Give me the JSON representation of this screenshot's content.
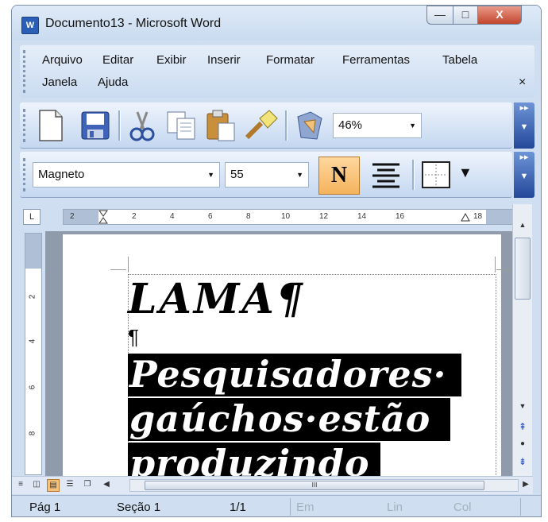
{
  "window": {
    "app_icon_glyph": "W",
    "title": "Documento13 - Microsoft Word",
    "minimize_glyph": "—",
    "maximize_glyph": "□",
    "close_glyph": "X"
  },
  "menu": {
    "items": [
      "Arquivo",
      "Editar",
      "Exibir",
      "Inserir",
      "Formatar",
      "Ferramentas",
      "Tabela",
      "Janela",
      "Ajuda"
    ],
    "close_glyph": "×"
  },
  "toolbar_standard": {
    "zoom": "46%",
    "icons": [
      "new-document-icon",
      "save-icon",
      "cut-icon",
      "copy-icon",
      "paste-icon",
      "format-painter-icon",
      "drawing-icon"
    ]
  },
  "toolbar_formatting": {
    "font": "Magneto",
    "size": "55",
    "bold_label": "N",
    "borders_arrow": "▼"
  },
  "ruler": {
    "corner": "L",
    "labels": [
      "2",
      "2",
      "4",
      "6",
      "8",
      "10",
      "12",
      "14",
      "16",
      "18"
    ],
    "vertical_labels": [
      "2",
      "4",
      "6",
      "8"
    ]
  },
  "document": {
    "line1": "LAMA¶",
    "pilcrow": "¶",
    "lines": [
      "Pesquisadores·",
      "gaúchos·estão",
      "produzindo"
    ]
  },
  "scrollbar": {
    "up": "▲",
    "down": "▼",
    "prev_page": "⇞",
    "select_browse": "●",
    "next_page": "⇟",
    "left": "◀",
    "right": "▶",
    "thumb_grip": "III"
  },
  "statusbar": {
    "page": "Pág 1",
    "section": "Seção 1",
    "pages": "1/1",
    "em": "Em",
    "lin": "Lin",
    "col": "Col"
  },
  "colors": {
    "accent": "#2b5fb7",
    "bold_active": "#f4b35d",
    "highlight": "#000000"
  }
}
